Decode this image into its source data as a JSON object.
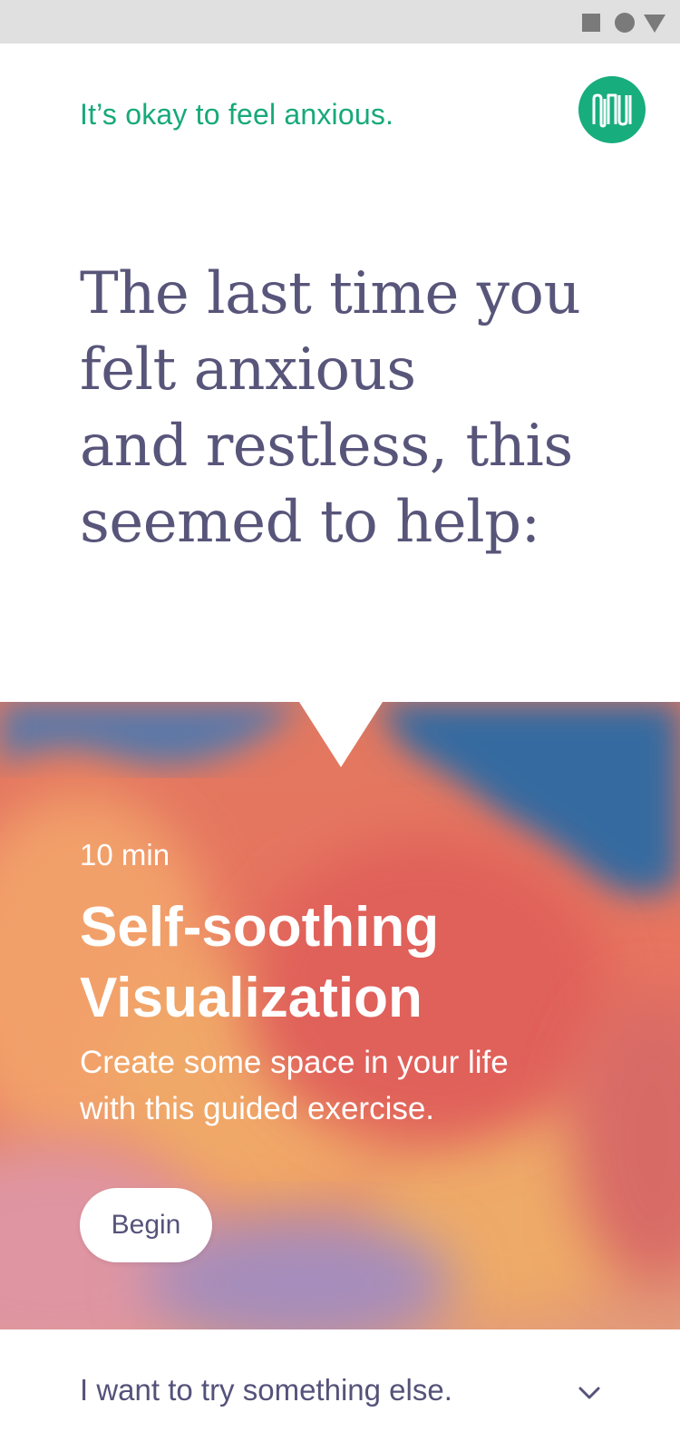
{
  "status_bar": {
    "icons": [
      "square-icon",
      "circle-icon",
      "triangle-icon"
    ]
  },
  "header": {
    "tagline": "It’s okay to feel anxious.",
    "logo_icon": "app-logo-icon"
  },
  "prompt": {
    "headline_lines": [
      "The last time you",
      "felt anxious",
      "and restless, this",
      "seemed to help:"
    ]
  },
  "card": {
    "duration": "10 min",
    "title_lines": [
      "Self-soothing",
      "Visualization"
    ],
    "description_lines": [
      "Create some space in your life",
      "with this guided exercise."
    ],
    "begin_label": "Begin"
  },
  "alternative": {
    "label": "I want to try something else.",
    "icon": "chevron-down-icon"
  },
  "colors": {
    "accent": "#17ad7c",
    "text": "#58557a",
    "sky_blue": "#356aa0",
    "cloud_red": "#e0655a",
    "cloud_orange": "#f0a060",
    "cloud_pink": "#e0929e",
    "cloud_purple": "#a08ab8"
  }
}
